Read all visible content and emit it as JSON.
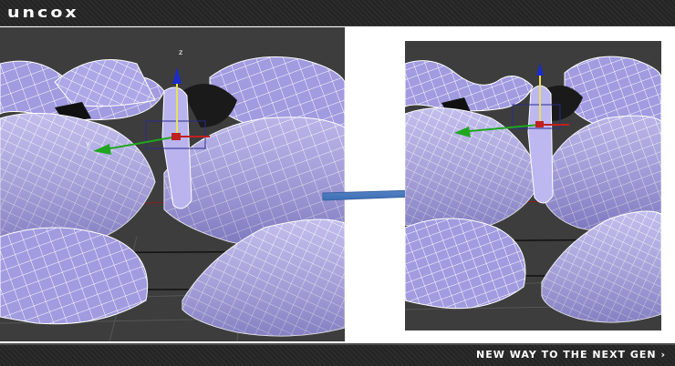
{
  "header": {
    "logo_text": "uncox"
  },
  "footer": {
    "tagline": "NEW WAY TO THE NEXT GEN ›"
  },
  "viewports": {
    "before": {
      "gizmo_axis_z": "z",
      "gizmo_axis_y": "y"
    },
    "after": {}
  },
  "colors": {
    "viewport_bg": "#3d3d3d",
    "mesh_fill": "#9e98de",
    "wire": "#ffffff",
    "axis_z": "#1c2cc8",
    "axis_y": "#1fa61f",
    "axis_x": "#c02020",
    "arrow": "#5b87c8"
  }
}
